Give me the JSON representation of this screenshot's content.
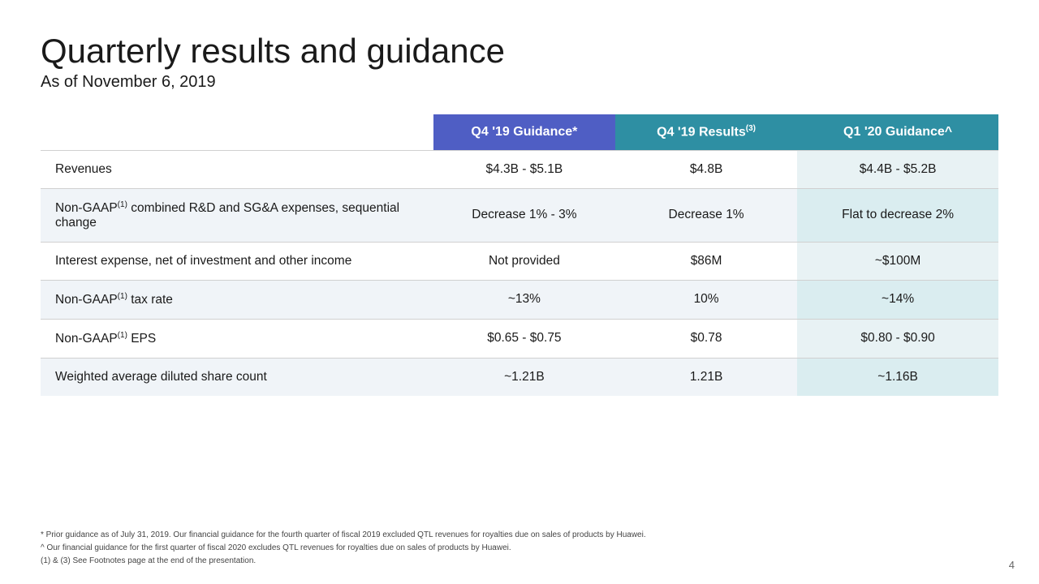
{
  "title": "Quarterly results and guidance",
  "subtitle": "As of November 6, 2019",
  "columns": {
    "q4_guidance_header": "Q4 '19 Guidance*",
    "q4_results_header": "Q4 '19 Results",
    "q4_results_superscript": "(3)",
    "q1_guidance_header": "Q1 '20 Guidance^"
  },
  "rows": [
    {
      "label": "Revenues",
      "label_sup": "",
      "q4_guidance": "$4.3B - $5.1B",
      "q4_results": "$4.8B",
      "q1_guidance": "$4.4B - $5.2B"
    },
    {
      "label": "Non-GAAP",
      "label_sup": "(1)",
      "label_rest": " combined R&D and SG&A expenses, sequential change",
      "q4_guidance": "Decrease 1% - 3%",
      "q4_results": "Decrease 1%",
      "q1_guidance": "Flat to decrease 2%"
    },
    {
      "label": "Interest expense, net of investment and other income",
      "label_sup": "",
      "q4_guidance": "Not provided",
      "q4_results": "$86M",
      "q1_guidance": "~$100M"
    },
    {
      "label": "Non-GAAP",
      "label_sup": "(1)",
      "label_rest": " tax rate",
      "q4_guidance": "~13%",
      "q4_results": "10%",
      "q1_guidance": "~14%"
    },
    {
      "label": "Non-GAAP",
      "label_sup": "(1)",
      "label_rest": " EPS",
      "q4_guidance": "$0.65 - $0.75",
      "q4_results": "$0.78",
      "q1_guidance": "$0.80 - $0.90"
    },
    {
      "label": "Weighted average diluted share count",
      "label_sup": "",
      "q4_guidance": "~1.21B",
      "q4_results": "1.21B",
      "q1_guidance": "~1.16B"
    }
  ],
  "footnotes": [
    "* Prior guidance as of July 31, 2019. Our financial guidance for the fourth quarter of fiscal 2019 excluded QTL revenues for royalties due on sales of products by Huawei.",
    "^ Our financial guidance for the first quarter of fiscal 2020 excludes QTL revenues for royalties due on sales of products by Huawei.",
    "(1) & (3) See Footnotes page at the end of the presentation."
  ],
  "page_number": "4"
}
